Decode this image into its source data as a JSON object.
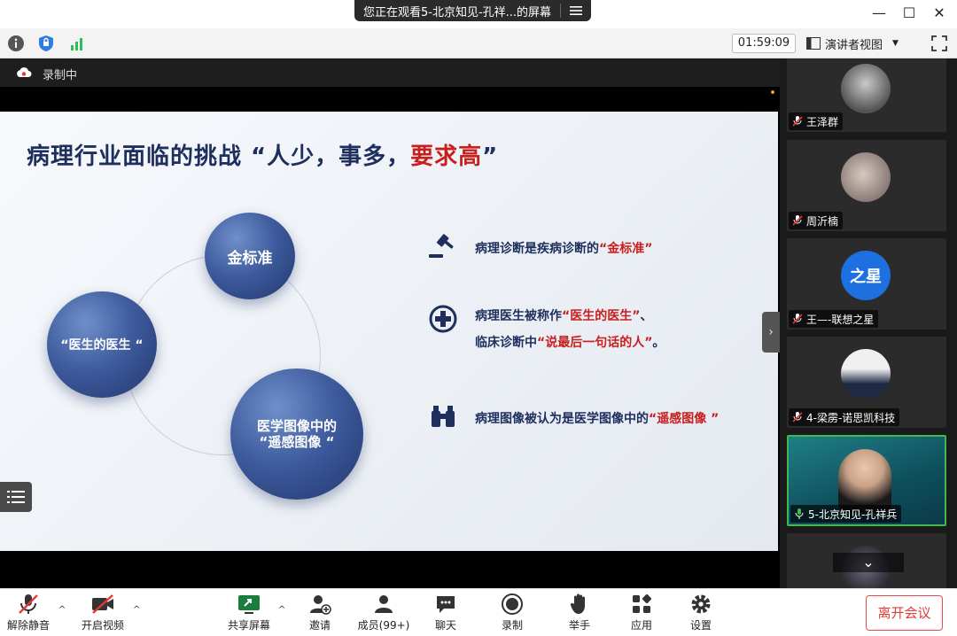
{
  "window": {
    "title": "您正在观看5-北京知见-孔祥...的屏幕",
    "minimize": "—",
    "maximize": "☐",
    "close": "✕"
  },
  "status": {
    "timer": "01:59:09",
    "view_mode": "演讲者视图",
    "view_caret": "▼"
  },
  "recording": {
    "label": "录制中"
  },
  "slide": {
    "title_main": "病理行业面临的挑战 “人少，事多，",
    "title_red": "要求高",
    "title_end": "”",
    "bubbles": {
      "gold": "金标准",
      "doctor": "“医生的医生 “",
      "remote_line1": "医学图像中的",
      "remote_line2": "“遥感图像 “"
    },
    "points": [
      {
        "text": "病理诊断是疾病诊断的",
        "red": "“金标准”",
        "tail": ""
      },
      {
        "text": "病理医生被称作",
        "red": "“医生的医生”",
        "tail": "、"
      },
      {
        "text": "临床诊断中",
        "red": "“说最后一句话的人”",
        "tail": "。"
      },
      {
        "text": "病理图像被认为是医学图像中的",
        "red": "“遥感图像 ”",
        "tail": ""
      }
    ]
  },
  "participants": [
    {
      "name": "王泽群"
    },
    {
      "name": "周沂楠"
    },
    {
      "name": "王—-联想之星",
      "avatar_text": "之星"
    },
    {
      "name": "4-梁雳-诺思凯科技"
    },
    {
      "name": "5-北京知见-孔祥兵"
    },
    {
      "name": ""
    }
  ],
  "gallery": {
    "collapse": "›",
    "scroll_down": "⌄"
  },
  "toolbar": {
    "mute": "解除静音",
    "video": "开启视频",
    "share": "共享屏幕",
    "invite": "邀请",
    "members": "成员(99+)",
    "chat": "聊天",
    "record": "录制",
    "raise_hand": "举手",
    "apps": "应用",
    "settings": "设置",
    "leave": "离开会议",
    "caret": "^"
  },
  "colors": {
    "accent_red": "#c81e1e",
    "navy": "#1e2f5e",
    "active_speaker": "#3fb950"
  }
}
